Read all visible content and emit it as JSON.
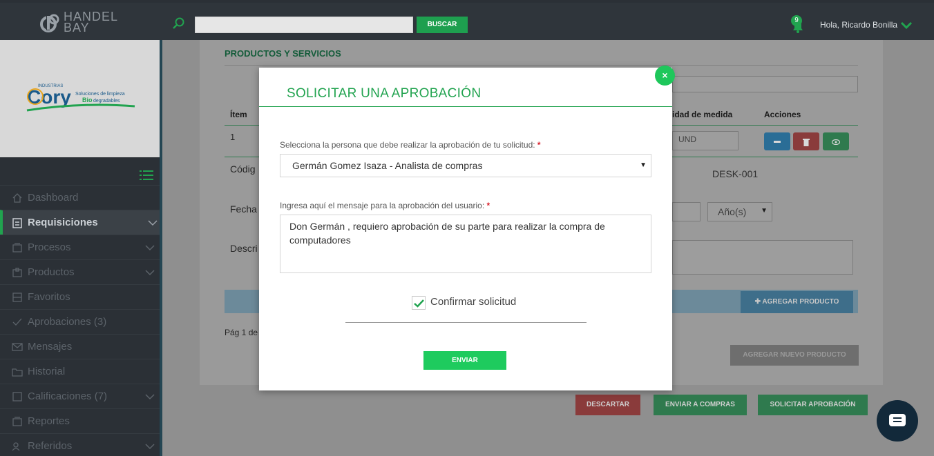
{
  "header": {
    "logo": {
      "line1": "HANDEL",
      "line2": "BAY",
      "icon": "handelbay-logo-icon"
    },
    "search": {
      "placeholder": "",
      "button_label": "BUSCAR",
      "icon": "search-icon"
    },
    "notifications": {
      "count": "9",
      "icon": "bell-icon"
    },
    "user": {
      "greeting": "Hola, Ricardo Bonilla",
      "icon": "chevron-down-icon"
    }
  },
  "sidebar": {
    "brand_logo": {
      "prefix": "INDUSTRIAS",
      "name": "Cory",
      "tagline1": "Soluciones de limpieza",
      "tagline2_prefix": "Bio",
      "tagline2": "degradables"
    },
    "items": [
      {
        "label": "Dashboard",
        "icon": "home-icon",
        "has_children": false,
        "active": false
      },
      {
        "label": "Requisiciones",
        "icon": "clipboard-icon",
        "has_children": true,
        "active": true
      },
      {
        "label": "Procesos",
        "icon": "inbox-icon",
        "has_children": true,
        "active": false
      },
      {
        "label": "Productos",
        "icon": "box-icon",
        "has_children": true,
        "active": false
      },
      {
        "label": "Favoritos",
        "icon": "archive-icon",
        "has_children": false,
        "active": false
      },
      {
        "label": "Aprobaciones (3)",
        "icon": "check-icon",
        "has_children": false,
        "active": false
      },
      {
        "label": "Mensajes",
        "icon": "mail-icon",
        "has_children": false,
        "active": false
      },
      {
        "label": "Historial",
        "icon": "folder-icon",
        "has_children": false,
        "active": false
      },
      {
        "label": "Calificaciones (7)",
        "icon": "square-icon",
        "has_children": true,
        "active": false
      },
      {
        "label": "Reportes",
        "icon": "report-icon",
        "has_children": false,
        "active": false
      },
      {
        "label": "Referidos",
        "icon": "people-icon",
        "has_children": true,
        "active": false
      }
    ]
  },
  "background": {
    "section_title": "PRODUCTOS Y SERVICIOS",
    "table": {
      "headers": [
        "Ítem",
        "idad de medida",
        "Acciones"
      ],
      "row": {
        "item": "1",
        "unit": "UND"
      }
    },
    "labels": {
      "codigo": "Códig",
      "fecha": "Fecha",
      "descripcion": "Descri",
      "codigo_value": "DESK-001",
      "period": "Año(s)"
    },
    "pagination": "Pág 1 de",
    "buttons": {
      "agregar_producto": "AGREGAR PRODUCTO",
      "agregar_nuevo": "AGREGAR NUEVO PRODUCTO",
      "descartar": "DESCARTAR",
      "enviar_compras": "ENVIAR A COMPRAS",
      "solicitar_aprobacion": "SOLICITAR APROBACIÓN"
    },
    "colors": {
      "green": "#21a34f",
      "red": "#d9232e",
      "blue": "#2a83c5"
    }
  },
  "modal": {
    "title": "SOLICITAR UNA APROBACIÓN",
    "close_label": "×",
    "approver_label": "Selecciona la persona que debe realizar la aprobación de tu solicitud:",
    "approver_value": "Germán Gomez Isaza - Analista de compras",
    "message_label": "Ingresa aquí el mensaje para la aprobación del usuario:",
    "message_value": "Don Germán , requiero aprobación de su parte para realizar la compra de computadores",
    "required_mark": "*",
    "confirm_label": "Confirmar solicitud",
    "confirm_checked": true,
    "submit_label": "ENVIAR"
  }
}
